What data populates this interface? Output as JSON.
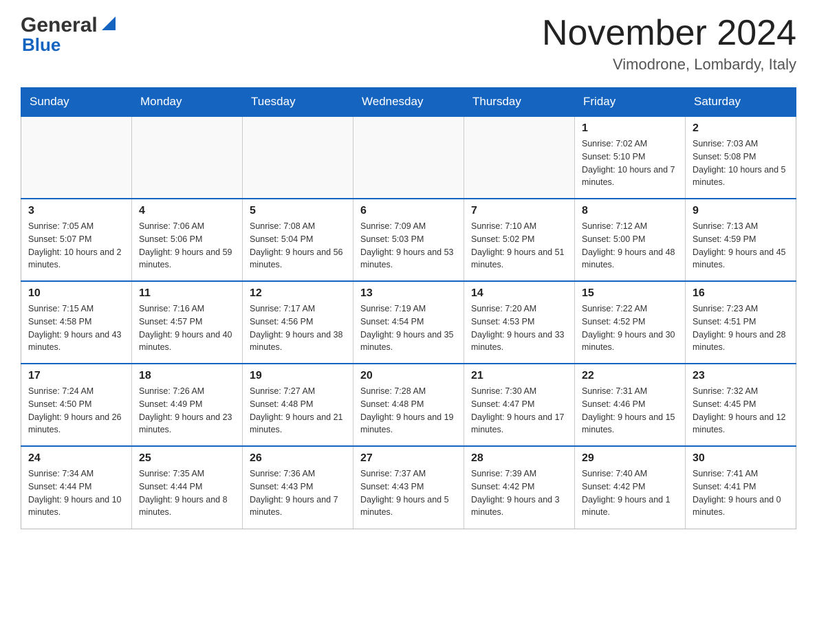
{
  "header": {
    "logo_general": "General",
    "logo_blue": "Blue",
    "month_title": "November 2024",
    "location": "Vimodrone, Lombardy, Italy"
  },
  "days_of_week": [
    "Sunday",
    "Monday",
    "Tuesday",
    "Wednesday",
    "Thursday",
    "Friday",
    "Saturday"
  ],
  "weeks": [
    [
      {
        "day": "",
        "info": ""
      },
      {
        "day": "",
        "info": ""
      },
      {
        "day": "",
        "info": ""
      },
      {
        "day": "",
        "info": ""
      },
      {
        "day": "",
        "info": ""
      },
      {
        "day": "1",
        "info": "Sunrise: 7:02 AM\nSunset: 5:10 PM\nDaylight: 10 hours and 7 minutes."
      },
      {
        "day": "2",
        "info": "Sunrise: 7:03 AM\nSunset: 5:08 PM\nDaylight: 10 hours and 5 minutes."
      }
    ],
    [
      {
        "day": "3",
        "info": "Sunrise: 7:05 AM\nSunset: 5:07 PM\nDaylight: 10 hours and 2 minutes."
      },
      {
        "day": "4",
        "info": "Sunrise: 7:06 AM\nSunset: 5:06 PM\nDaylight: 9 hours and 59 minutes."
      },
      {
        "day": "5",
        "info": "Sunrise: 7:08 AM\nSunset: 5:04 PM\nDaylight: 9 hours and 56 minutes."
      },
      {
        "day": "6",
        "info": "Sunrise: 7:09 AM\nSunset: 5:03 PM\nDaylight: 9 hours and 53 minutes."
      },
      {
        "day": "7",
        "info": "Sunrise: 7:10 AM\nSunset: 5:02 PM\nDaylight: 9 hours and 51 minutes."
      },
      {
        "day": "8",
        "info": "Sunrise: 7:12 AM\nSunset: 5:00 PM\nDaylight: 9 hours and 48 minutes."
      },
      {
        "day": "9",
        "info": "Sunrise: 7:13 AM\nSunset: 4:59 PM\nDaylight: 9 hours and 45 minutes."
      }
    ],
    [
      {
        "day": "10",
        "info": "Sunrise: 7:15 AM\nSunset: 4:58 PM\nDaylight: 9 hours and 43 minutes."
      },
      {
        "day": "11",
        "info": "Sunrise: 7:16 AM\nSunset: 4:57 PM\nDaylight: 9 hours and 40 minutes."
      },
      {
        "day": "12",
        "info": "Sunrise: 7:17 AM\nSunset: 4:56 PM\nDaylight: 9 hours and 38 minutes."
      },
      {
        "day": "13",
        "info": "Sunrise: 7:19 AM\nSunset: 4:54 PM\nDaylight: 9 hours and 35 minutes."
      },
      {
        "day": "14",
        "info": "Sunrise: 7:20 AM\nSunset: 4:53 PM\nDaylight: 9 hours and 33 minutes."
      },
      {
        "day": "15",
        "info": "Sunrise: 7:22 AM\nSunset: 4:52 PM\nDaylight: 9 hours and 30 minutes."
      },
      {
        "day": "16",
        "info": "Sunrise: 7:23 AM\nSunset: 4:51 PM\nDaylight: 9 hours and 28 minutes."
      }
    ],
    [
      {
        "day": "17",
        "info": "Sunrise: 7:24 AM\nSunset: 4:50 PM\nDaylight: 9 hours and 26 minutes."
      },
      {
        "day": "18",
        "info": "Sunrise: 7:26 AM\nSunset: 4:49 PM\nDaylight: 9 hours and 23 minutes."
      },
      {
        "day": "19",
        "info": "Sunrise: 7:27 AM\nSunset: 4:48 PM\nDaylight: 9 hours and 21 minutes."
      },
      {
        "day": "20",
        "info": "Sunrise: 7:28 AM\nSunset: 4:48 PM\nDaylight: 9 hours and 19 minutes."
      },
      {
        "day": "21",
        "info": "Sunrise: 7:30 AM\nSunset: 4:47 PM\nDaylight: 9 hours and 17 minutes."
      },
      {
        "day": "22",
        "info": "Sunrise: 7:31 AM\nSunset: 4:46 PM\nDaylight: 9 hours and 15 minutes."
      },
      {
        "day": "23",
        "info": "Sunrise: 7:32 AM\nSunset: 4:45 PM\nDaylight: 9 hours and 12 minutes."
      }
    ],
    [
      {
        "day": "24",
        "info": "Sunrise: 7:34 AM\nSunset: 4:44 PM\nDaylight: 9 hours and 10 minutes."
      },
      {
        "day": "25",
        "info": "Sunrise: 7:35 AM\nSunset: 4:44 PM\nDaylight: 9 hours and 8 minutes."
      },
      {
        "day": "26",
        "info": "Sunrise: 7:36 AM\nSunset: 4:43 PM\nDaylight: 9 hours and 7 minutes."
      },
      {
        "day": "27",
        "info": "Sunrise: 7:37 AM\nSunset: 4:43 PM\nDaylight: 9 hours and 5 minutes."
      },
      {
        "day": "28",
        "info": "Sunrise: 7:39 AM\nSunset: 4:42 PM\nDaylight: 9 hours and 3 minutes."
      },
      {
        "day": "29",
        "info": "Sunrise: 7:40 AM\nSunset: 4:42 PM\nDaylight: 9 hours and 1 minute."
      },
      {
        "day": "30",
        "info": "Sunrise: 7:41 AM\nSunset: 4:41 PM\nDaylight: 9 hours and 0 minutes."
      }
    ]
  ]
}
